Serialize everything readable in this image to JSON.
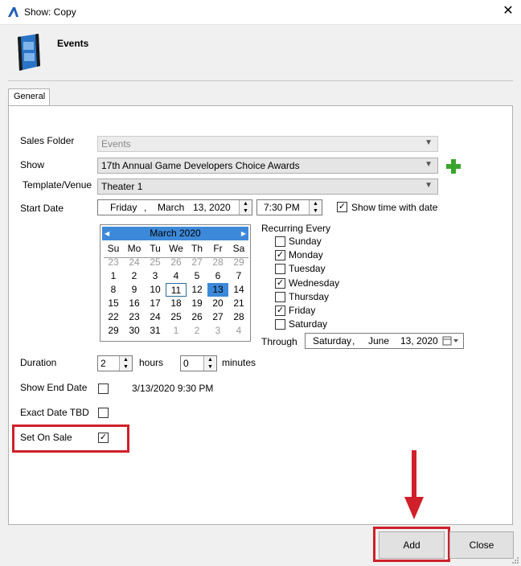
{
  "window": {
    "title": "Show: Copy",
    "close_label": "✕"
  },
  "header": {
    "title": "Events"
  },
  "tabs": [
    {
      "label": "General"
    }
  ],
  "form": {
    "sales_folder_label": "Sales Folder",
    "sales_folder_value": "Events",
    "show_label": "Show",
    "show_value": "17th Annual Game Developers Choice Awards",
    "template_label": "Template/Venue",
    "template_value": "Theater 1",
    "start_date_label": "Start Date",
    "start_date": {
      "weekday": "Friday",
      "comma": ",",
      "month": "March",
      "day_year": "13, 2020"
    },
    "start_time": "7:30 PM",
    "show_time_label": "Show time with date",
    "recurring_label": "Recurring Every",
    "days": [
      {
        "label": "Sunday",
        "checked": ""
      },
      {
        "label": "Monday",
        "checked": "✓"
      },
      {
        "label": "Tuesday",
        "checked": ""
      },
      {
        "label": "Wednesday",
        "checked": "✓"
      },
      {
        "label": "Thursday",
        "checked": ""
      },
      {
        "label": "Friday",
        "checked": "✓"
      },
      {
        "label": "Saturday",
        "checked": ""
      }
    ],
    "through_label": "Through",
    "through_date": {
      "weekday": "Saturday",
      "comma": ",",
      "month": "June",
      "day_year": "13, 2020"
    },
    "duration_label": "Duration",
    "hours_value": "2",
    "hours_label": "hours",
    "minutes_value": "0",
    "minutes_label": "minutes",
    "show_end_label": "Show End Date",
    "show_end_value": "3/13/2020 9:30 PM",
    "exact_tbd_label": "Exact Date TBD",
    "set_on_sale_label": "Set On Sale",
    "set_on_sale_checked": "✓",
    "show_time_checked": "✓"
  },
  "calendar": {
    "month": "March",
    "year": "2020",
    "prev": "◀",
    "next": "▶",
    "dow": [
      "Su",
      "Mo",
      "Tu",
      "We",
      "Th",
      "Fr",
      "Sa"
    ],
    "weeks": [
      [
        "23",
        "24",
        "25",
        "26",
        "27",
        "28",
        "29"
      ],
      [
        "1",
        "2",
        "3",
        "4",
        "5",
        "6",
        "7"
      ],
      [
        "8",
        "9",
        "10",
        "11",
        "12",
        "13",
        "14"
      ],
      [
        "15",
        "16",
        "17",
        "18",
        "19",
        "20",
        "21"
      ],
      [
        "22",
        "23",
        "24",
        "25",
        "26",
        "27",
        "28"
      ],
      [
        "29",
        "30",
        "31",
        "1",
        "2",
        "3",
        "4"
      ]
    ]
  },
  "buttons": {
    "add": "Add",
    "close": "Close"
  },
  "colors": {
    "accent": "#3d89d9",
    "highlight": "#d0202a"
  }
}
